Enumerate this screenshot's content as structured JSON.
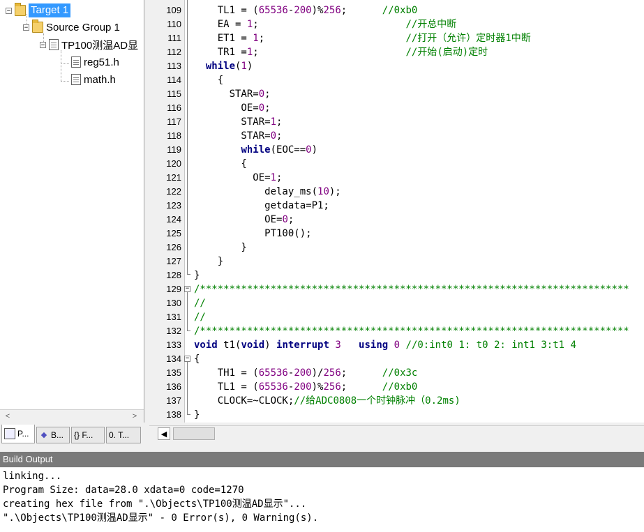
{
  "project": {
    "target": "Target 1",
    "group": "Source Group 1",
    "source_file": "TP100测温AD显",
    "headers": [
      "reg51.h",
      "math.h"
    ],
    "tabs": [
      "P...",
      "B...",
      "{} F...",
      "0. T..."
    ]
  },
  "editor": {
    "lines": [
      {
        "n": "109",
        "code": "    TL1 = (65536-200)%256;      //0xb0"
      },
      {
        "n": "110",
        "code": "    EA = 1;                         //开总中断"
      },
      {
        "n": "111",
        "code": "    ET1 = 1;                        //打开（允许）定时器1中断"
      },
      {
        "n": "112",
        "code": "    TR1 =1;                         //开始(启动)定时"
      },
      {
        "n": "113",
        "code": "  while(1)"
      },
      {
        "n": "114",
        "code": "    {"
      },
      {
        "n": "115",
        "code": "      STAR=0;"
      },
      {
        "n": "116",
        "code": "        OE=0;"
      },
      {
        "n": "117",
        "code": "        STAR=1;"
      },
      {
        "n": "118",
        "code": "        STAR=0;"
      },
      {
        "n": "119",
        "code": "        while(EOC==0)"
      },
      {
        "n": "120",
        "code": "        {"
      },
      {
        "n": "121",
        "code": "          OE=1;"
      },
      {
        "n": "122",
        "code": "            delay_ms(10);"
      },
      {
        "n": "123",
        "code": "            getdata=P1;"
      },
      {
        "n": "124",
        "code": "            OE=0;"
      },
      {
        "n": "125",
        "code": "            PT100();"
      },
      {
        "n": "126",
        "code": "        }"
      },
      {
        "n": "127",
        "code": "    }"
      },
      {
        "n": "128",
        "code": "}"
      },
      {
        "n": "129",
        "code": "/*************************************************************************"
      },
      {
        "n": "130",
        "code": "//"
      },
      {
        "n": "131",
        "code": "//"
      },
      {
        "n": "132",
        "code": "/*************************************************************************"
      },
      {
        "n": "133",
        "code": "void t1(void) interrupt 3   using 0 //0:int0 1: t0 2: int1 3:t1 4"
      },
      {
        "n": "134",
        "code": "{"
      },
      {
        "n": "135",
        "code": "    TH1 = (65536-200)/256;      //0x3c"
      },
      {
        "n": "136",
        "code": "    TL1 = (65536-200)%256;      //0xb0"
      },
      {
        "n": "137",
        "code": "    CLOCK=~CLOCK;//给ADC0808一个时钟脉冲（0.2ms)"
      },
      {
        "n": "138",
        "code": "}"
      }
    ]
  },
  "build": {
    "title": "Build Output",
    "lines": [
      "linking...",
      "Program Size: data=28.0 xdata=0 code=1270",
      "creating hex file from \".\\Objects\\TP100测温AD显示\"...",
      "\".\\Objects\\TP100测温AD显示\" - 0 Error(s), 0 Warning(s)."
    ]
  }
}
